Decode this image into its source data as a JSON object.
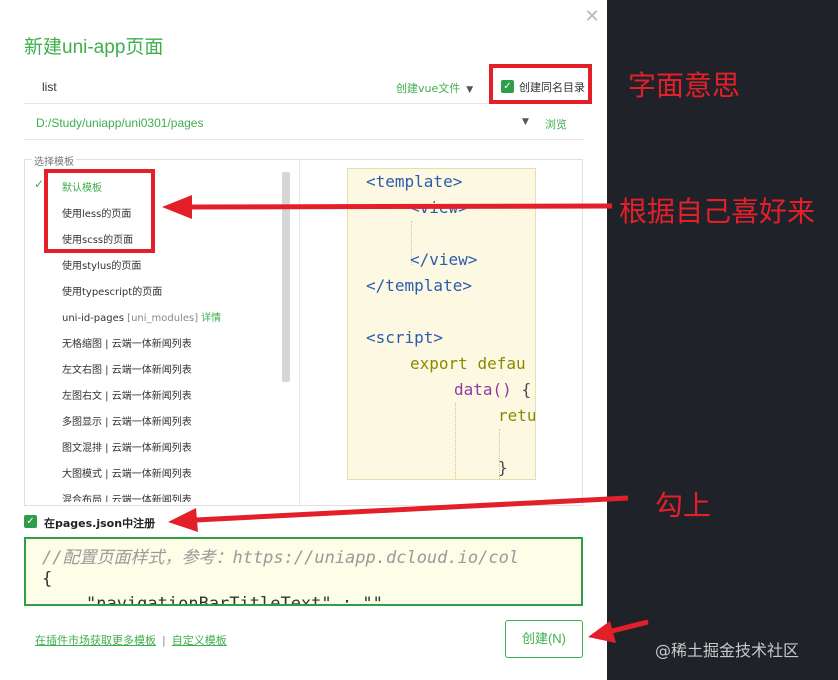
{
  "dialog": {
    "title": "新建uni-app页面",
    "close_icon": "close-icon",
    "page_name": "list",
    "create_vue_label": "创建vue文件",
    "create_dir_label": "创建同名目录",
    "create_dir_checked": true,
    "path": "D:/Study/uniapp/uni0301/pages",
    "browse_label": "浏览",
    "template_legend": "选择模板",
    "templates": [
      {
        "label": "默认模板",
        "selected": true
      },
      {
        "label": "使用less的页面"
      },
      {
        "label": "使用scss的页面"
      },
      {
        "label": "使用stylus的页面"
      },
      {
        "label": "使用typescript的页面"
      },
      {
        "label": "uni-id-pages",
        "muted": "[uni_modules]",
        "link": "详情"
      },
      {
        "label": "无格缩图 | 云端一体新闻列表"
      },
      {
        "label": "左文右图 | 云端一体新闻列表"
      },
      {
        "label": "左图右文 | 云端一体新闻列表"
      },
      {
        "label": "多图显示 | 云端一体新闻列表"
      },
      {
        "label": "图文混排 | 云端一体新闻列表"
      },
      {
        "label": "大图模式 | 云端一体新闻列表"
      },
      {
        "label": "混合布局 | 云端一体新闻列表"
      }
    ],
    "code_preview": {
      "template_open": "<template>",
      "view_open": "<view>",
      "view_close": "</view>",
      "template_close": "</template>",
      "script_open": "<script>",
      "export_kw": "export",
      "export_rest": "defau",
      "data_fn": "data()",
      "data_rest": "{",
      "return_kw": "retu",
      "brace": "}"
    },
    "register_label": "在pages.json中注册",
    "register_checked": true,
    "json_comment": "//配置页面样式，参考：https://uniapp.dcloud.io/col",
    "json_open_brace": "{",
    "json_partial": "\"navigationBarTitleText\" : \"\"",
    "plugin_link": "在插件市场获取更多模板",
    "custom_link": "自定义模板",
    "create_button": "创建(N)"
  },
  "annotations": {
    "literal_meaning": "字面意思",
    "preference": "根据自己喜好来",
    "check_it": "勾上",
    "accent_color": "#e3202a"
  },
  "watermark": "@稀土掘金技术社区",
  "colors": {
    "brand_green": "#3fae4d",
    "dark_panel": "#1f2228",
    "code_bg": "#fdf8e1"
  }
}
